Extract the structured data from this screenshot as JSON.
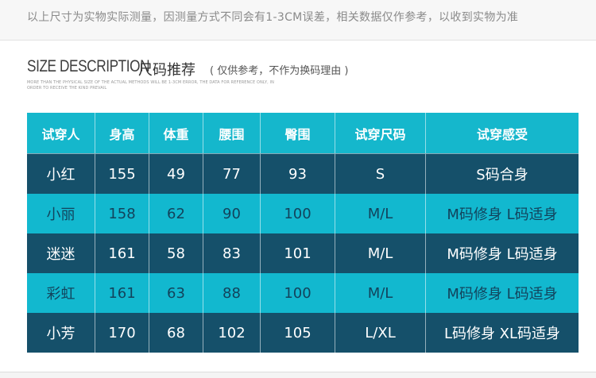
{
  "top_note": "以上尺寸为实物实际测量，因测量方式不同会有1-3CM误差，相关数据仅作参考，以收到实物为准",
  "heading": {
    "english": "Size description",
    "chinese": "尺码推荐",
    "subtitle": "( 仅供参考，不作为换码理由 )"
  },
  "disclaimer": "More than the physical size of the actual methods will be 1-3cm error, the data for reference only, in order to receive the kind prevail",
  "table": {
    "headers": [
      "试穿人",
      "身高",
      "体重",
      "腰围",
      "臀围",
      "试穿尺码",
      "试穿感受"
    ],
    "rows": [
      [
        "小红",
        "155",
        "49",
        "77",
        "93",
        "S",
        "S码合身"
      ],
      [
        "小丽",
        "158",
        "62",
        "90",
        "100",
        "M/L",
        "M码修身 L码适身"
      ],
      [
        "迷迷",
        "161",
        "58",
        "83",
        "101",
        "M/L",
        "M码修身 L码适身"
      ],
      [
        "彩虹",
        "161",
        "63",
        "88",
        "100",
        "M/L",
        "M码修身 L码适身"
      ],
      [
        "小芳",
        "170",
        "68",
        "102",
        "105",
        "L/XL",
        "L码修身 XL码适身"
      ]
    ]
  },
  "colors": {
    "header_bg": "#15b7cc",
    "dark_row_bg": "#15506a",
    "light_row_bg": "#12b8cf"
  }
}
